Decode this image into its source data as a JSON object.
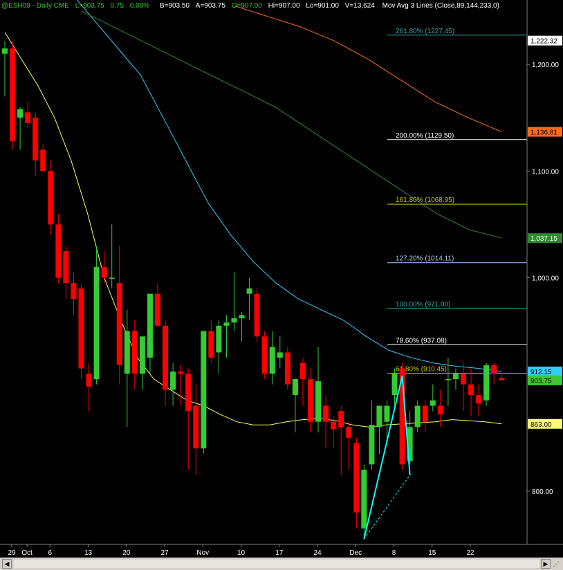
{
  "header": {
    "symbol": "@ESH09 - Daily CME",
    "last": "L=903.75",
    "change": "0.75",
    "pct": "0.08%",
    "bid": "B=903.50",
    "ask": "A=903.75",
    "open": "O=907.00",
    "high": "Hi=907.00",
    "low": "Lo=901.00",
    "volume": "V=13,624",
    "study": "Mov Avg 3 Lines (Close,89,144,233,0)"
  },
  "colors": {
    "up": "#33cc33",
    "down": "#ff0000",
    "ma_short": "#ffff66",
    "ma_mid": "#33ccff",
    "ma_long": "#2e8b2e",
    "ma_longest": "#ff6a1a",
    "fib": "#ffffff",
    "proj": "#00ffff"
  },
  "chart_data": {
    "type": "candlestick",
    "y_ticks": [
      "1,200.00",
      "1,100.00",
      "1,000.00",
      "800.00"
    ],
    "x_ticks": [
      "29",
      "Oct",
      "6",
      "13",
      "20",
      "27",
      "Nov",
      "10",
      "17",
      "24",
      "Dec",
      "8",
      "15",
      "22"
    ],
    "ylim": [
      750,
      1250
    ],
    "price_labels": [
      {
        "text": "1,222.32",
        "value": 1222.32,
        "bg": "#ffffff",
        "fg": "#000000"
      },
      {
        "text": "1,136.81",
        "value": 1136.81,
        "bg": "#ff6a1a",
        "fg": "#000000"
      },
      {
        "text": "1,037.15",
        "value": 1037.15,
        "bg": "#2e8b2e",
        "fg": "#ffffff"
      },
      {
        "text": "912.15",
        "value": 912.15,
        "bg": "#33ccff",
        "fg": "#000000"
      },
      {
        "text": "903.75",
        "value": 903.75,
        "bg": "#33cc33",
        "fg": "#000000"
      },
      {
        "text": "863.00",
        "value": 863.0,
        "bg": "#ffff66",
        "fg": "#000000"
      }
    ],
    "fib_levels": [
      {
        "text": "261.80% (1227.45)",
        "value": 1227.45,
        "color": "#3fa8a8"
      },
      {
        "text": "200.00% (1129.50)",
        "value": 1129.5,
        "color": "#ffffff"
      },
      {
        "text": "161.80% (1068.95)",
        "value": 1068.95,
        "color": "#c8c800"
      },
      {
        "text": "127.20% (1014.11)",
        "value": 1014.11,
        "color": "#aaccff"
      },
      {
        "text": "100.00% (971.00)",
        "value": 971.0,
        "color": "#3fa8a8"
      },
      {
        "text": "78.60% (937.08)",
        "value": 937.08,
        "color": "#ffffff"
      },
      {
        "text": "61.80% (910.45)",
        "value": 910.45,
        "color": "#c8c800"
      }
    ],
    "candles": [
      [
        1210,
        1222,
        1170,
        1215
      ],
      [
        1215,
        1222,
        1120,
        1128
      ],
      [
        1150,
        1160,
        1120,
        1158
      ],
      [
        1155,
        1165,
        1140,
        1145
      ],
      [
        1150,
        1155,
        1095,
        1110
      ],
      [
        1120,
        1125,
        1100,
        1100
      ],
      [
        1100,
        1110,
        1040,
        1050
      ],
      [
        1050,
        1060,
        995,
        1000
      ],
      [
        1025,
        1030,
        980,
        995
      ],
      [
        995,
        1005,
        965,
        980
      ],
      [
        990,
        995,
        905,
        915
      ],
      [
        910,
        920,
        875,
        898
      ],
      [
        905,
        1030,
        900,
        1010
      ],
      [
        1010,
        1025,
        995,
        1000
      ],
      [
        1000,
        1050,
        990,
        1000
      ],
      [
        995,
        1030,
        900,
        918
      ],
      [
        910,
        970,
        860,
        950
      ],
      [
        950,
        960,
        895,
        910
      ],
      [
        910,
        945,
        895,
        945
      ],
      [
        925,
        985,
        910,
        985
      ],
      [
        985,
        995,
        955,
        955
      ],
      [
        955,
        960,
        880,
        895
      ],
      [
        895,
        920,
        880,
        912
      ],
      [
        912,
        918,
        880,
        910
      ],
      [
        910,
        915,
        820,
        875
      ],
      [
        880,
        900,
        815,
        840
      ],
      [
        840,
        950,
        835,
        950
      ],
      [
        950,
        960,
        920,
        925
      ],
      [
        930,
        960,
        910,
        955
      ],
      [
        955,
        965,
        925,
        958
      ],
      [
        958,
        1005,
        950,
        962
      ],
      [
        962,
        968,
        940,
        965
      ],
      [
        985,
        1000,
        960,
        990
      ],
      [
        985,
        990,
        940,
        945
      ],
      [
        945,
        950,
        905,
        910
      ],
      [
        910,
        950,
        900,
        935
      ],
      [
        925,
        945,
        915,
        930
      ],
      [
        930,
        935,
        895,
        900
      ],
      [
        890,
        905,
        855,
        905
      ],
      [
        920,
        925,
        880,
        905
      ],
      [
        905,
        915,
        855,
        865
      ],
      [
        865,
        935,
        855,
        903
      ],
      [
        880,
        890,
        840,
        865
      ],
      [
        865,
        870,
        840,
        858
      ],
      [
        875,
        880,
        815,
        860
      ],
      [
        860,
        865,
        820,
        850
      ],
      [
        845,
        850,
        765,
        780
      ],
      [
        765,
        825,
        755,
        820
      ],
      [
        825,
        885,
        820,
        862
      ],
      [
        860,
        870,
        835,
        880
      ],
      [
        865,
        885,
        850,
        880
      ],
      [
        890,
        915,
        880,
        910
      ],
      [
        915,
        920,
        820,
        825
      ],
      [
        828,
        875,
        825,
        860
      ],
      [
        860,
        885,
        855,
        880
      ],
      [
        880,
        885,
        855,
        865
      ],
      [
        880,
        900,
        875,
        885
      ],
      [
        880,
        895,
        860,
        872
      ],
      [
        905,
        925,
        880,
        905
      ],
      [
        905,
        915,
        895,
        910
      ],
      [
        910,
        920,
        875,
        900
      ],
      [
        900,
        915,
        870,
        890
      ],
      [
        890,
        900,
        870,
        882
      ],
      [
        885,
        920,
        880,
        918
      ],
      [
        918,
        920,
        900,
        910
      ],
      [
        906,
        909,
        904,
        903.75
      ]
    ],
    "ma_short": [
      1230,
      1205,
      1180,
      1150,
      1110,
      1060,
      1000,
      960,
      925,
      905,
      895,
      885,
      880,
      872,
      865,
      862,
      862,
      865,
      867,
      868,
      866,
      862,
      860,
      862,
      863,
      864,
      865,
      867,
      866,
      865,
      863
    ],
    "ma_mid": [
      1290,
      1280,
      1265,
      1240,
      1215,
      1190,
      1150,
      1110,
      1070,
      1040,
      1015,
      995,
      980,
      970,
      960,
      945,
      932,
      925,
      920,
      917,
      915,
      912.15
    ],
    "ma_long": [
      1250,
      1235,
      1220,
      1205,
      1190,
      1175,
      1160,
      1140,
      1120,
      1100,
      1080,
      1060,
      1045,
      1037.15
    ],
    "ma_longest": [
      1255,
      1245,
      1235,
      1222,
      1205,
      1185,
      1165,
      1150,
      1136.81
    ]
  }
}
